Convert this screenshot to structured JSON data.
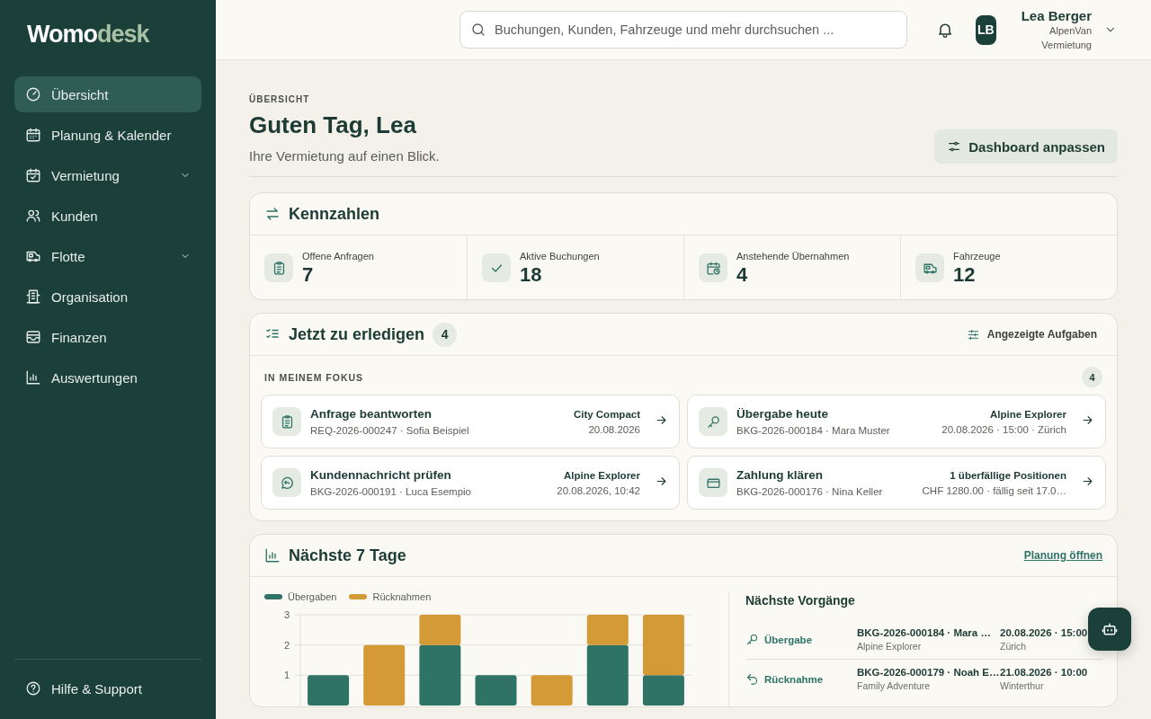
{
  "sidebar": {
    "logo": {
      "primary": "Womo",
      "accent": "desk"
    },
    "items": [
      {
        "label": "Übersicht",
        "kind": "link",
        "selected": true
      },
      {
        "label": "Planung & Kalender",
        "kind": "link",
        "selected": false
      },
      {
        "label": "Vermietung",
        "kind": "group",
        "selected": false
      },
      {
        "label": "Kunden",
        "kind": "link",
        "selected": false
      },
      {
        "label": "Flotte",
        "kind": "group",
        "selected": false
      },
      {
        "label": "Organisation",
        "kind": "link",
        "selected": false
      },
      {
        "label": "Finanzen",
        "kind": "link",
        "selected": false
      },
      {
        "label": "Auswertungen",
        "kind": "link",
        "selected": false
      }
    ],
    "footer": {
      "label": "Hilfe & Support"
    }
  },
  "header": {
    "search": {
      "placeholder": "Buchungen, Kunden, Fahrzeuge und mehr durchsuchen ..."
    },
    "user": {
      "initials": "LB",
      "name": "Lea Berger",
      "org": "AlpenVan Vermietung"
    }
  },
  "page": {
    "eyebrow": "ÜBERSICHT",
    "title": "Guten Tag, Lea",
    "subtitle": "Ihre Vermietung auf einen Blick.",
    "action": "Dashboard anpassen"
  },
  "kpis": {
    "title": "Kennzahlen",
    "items": [
      {
        "label": "Offene Anfragen",
        "value": "7"
      },
      {
        "label": "Aktive Buchungen",
        "value": "18"
      },
      {
        "label": "Anstehende Übernahmen",
        "value": "4"
      },
      {
        "label": "Fahrzeuge",
        "value": "12"
      }
    ]
  },
  "tasks": {
    "title": "Jetzt zu erledigen",
    "count": "4",
    "filter": "Angezeigte Aufgaben",
    "section": "IN MEINEM FOKUS",
    "section_count": "4",
    "items": [
      {
        "title": "Anfrage beantworten",
        "ref": "REQ-2026-000247 · Sofia Beispiel",
        "tag": "City Compact",
        "meta": "20.08.2026"
      },
      {
        "title": "Übergabe heute",
        "ref": "BKG-2026-000184 · Mara Muster",
        "tag": "Alpine Explorer",
        "meta": "20.08.2026 · 15:00 · Zürich"
      },
      {
        "title": "Kundennachricht prüfen",
        "ref": "BKG-2026-000191 · Luca Esempio",
        "tag": "Alpine Explorer",
        "meta": "20.08.2026, 10:42"
      },
      {
        "title": "Zahlung klären",
        "ref": "BKG-2026-000176 · Nina Keller",
        "tag": "1 überfällige Positionen",
        "meta": "CHF 1280.00 · fällig seit 17.0…"
      }
    ]
  },
  "week": {
    "title": "Nächste 7 Tage",
    "link": "Planung öffnen",
    "chart_data": {
      "type": "bar",
      "stacked": true,
      "legend": "top-left",
      "ylim": [
        0,
        3
      ],
      "yticks": [
        1,
        2,
        3
      ],
      "series": [
        {
          "name": "Übergaben",
          "color": "#2e7366",
          "values": [
            1,
            0,
            2,
            1,
            0,
            2,
            1
          ]
        },
        {
          "name": "Rücknahmen",
          "color": "#d39a35",
          "values": [
            0,
            2,
            1,
            0,
            1,
            1,
            2
          ]
        }
      ]
    },
    "upcoming": {
      "title": "Nächste Vorgänge",
      "rows": [
        {
          "kind": "handover",
          "type": "Übergabe",
          "ref": "BKG-2026-000184 · Mara …",
          "vehicle": "Alpine Explorer",
          "when": "20.08.2026 · 15:00",
          "place": "Zürich"
        },
        {
          "kind": "return",
          "type": "Rücknahme",
          "ref": "BKG-2026-000179 · Noah E…",
          "vehicle": "Family Adventure",
          "when": "21.08.2026 · 10:00",
          "place": "Winterthur"
        }
      ]
    }
  }
}
